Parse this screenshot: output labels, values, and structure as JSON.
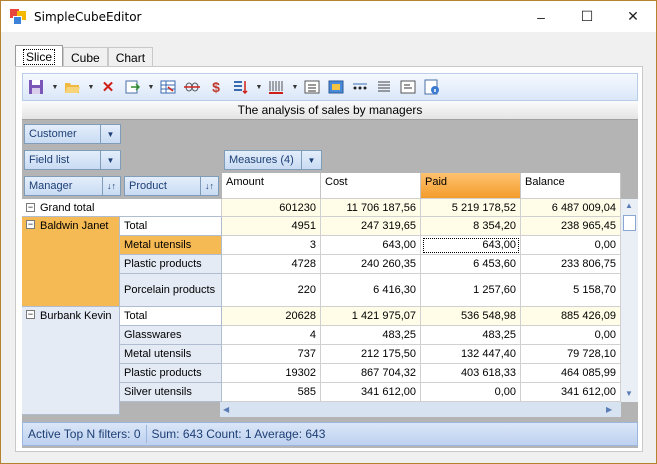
{
  "window": {
    "title": "SimpleCubeEditor",
    "controls": [
      "–",
      "☐",
      "✕"
    ]
  },
  "tabs": [
    "Slice",
    "Cube",
    "Chart"
  ],
  "toolbar": {
    "icons": [
      "save-icon",
      "open-icon",
      "delete-icon",
      "export-icon",
      "grid-icon",
      "strikethrough-icon",
      "dollar-icon",
      "sort-icon",
      "filter-icon",
      "align-icon",
      "image-icon",
      "dots-icon",
      "list-icon",
      "details-icon",
      "info-icon"
    ]
  },
  "grid": {
    "caption": "The analysis of sales by managers",
    "filter_customer": "Customer",
    "field_list": "Field list",
    "measures": "Measures (4)",
    "row_fields": [
      "Manager",
      "Product"
    ],
    "columns": [
      "Amount",
      "Cost",
      "Paid",
      "Balance"
    ],
    "grand_total": {
      "label": "Grand total",
      "values": [
        "601230",
        "11 706 187,56",
        "5 219 178,52",
        "6 487 009,04"
      ]
    },
    "managers": [
      {
        "name": "Baldwin  Janet",
        "rows": [
          {
            "product": "Total",
            "values": [
              "4951",
              "247 319,65",
              "8 354,20",
              "238 965,45"
            ]
          },
          {
            "product": "Metal utensils",
            "values": [
              "3",
              "643,00",
              "643,00",
              "0,00"
            ]
          },
          {
            "product": "Plastic products",
            "values": [
              "4728",
              "240 260,35",
              "6 453,60",
              "233 806,75"
            ]
          },
          {
            "product": "Porcelain products",
            "values": [
              "220",
              "6 416,30",
              "1 257,60",
              "5 158,70"
            ]
          }
        ]
      },
      {
        "name": "Burbank Kevin",
        "rows": [
          {
            "product": "Total",
            "values": [
              "20628",
              "1 421 975,07",
              "536 548,98",
              "885 426,09"
            ]
          },
          {
            "product": "Glasswares",
            "values": [
              "4",
              "483,25",
              "483,25",
              "0,00"
            ]
          },
          {
            "product": "Metal utensils",
            "values": [
              "737",
              "212 175,50",
              "132 447,40",
              "79 728,10"
            ]
          },
          {
            "product": "Plastic products",
            "values": [
              "19302",
              "867 704,32",
              "403 618,33",
              "464 085,99"
            ]
          },
          {
            "product": "Silver utensils",
            "values": [
              "585",
              "341 612,00",
              "0,00",
              "341 612,00"
            ]
          }
        ]
      }
    ]
  },
  "status": {
    "filters": "Active Top N filters: 0",
    "summary": "Sum: 643 Count: 1 Average: 643"
  }
}
